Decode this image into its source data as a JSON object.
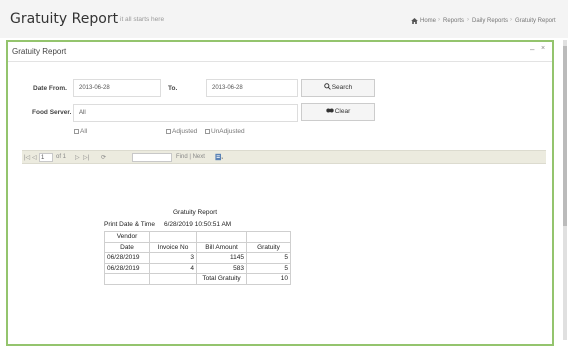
{
  "header": {
    "title": "Gratuity Report",
    "subtitle": "it all starts here",
    "breadcrumb": [
      "Home",
      "Reports",
      "Daily Reports",
      "Gratuity Report"
    ]
  },
  "panel": {
    "title": "Gratuity Report",
    "minimize": "–",
    "close": "×"
  },
  "form": {
    "date_from_label": "Date From.",
    "date_from_value": "2013-06-28",
    "to_label": "To.",
    "to_value": "2013-06-28",
    "search_label": "Search",
    "food_server_label": "Food Server.",
    "food_server_value": "All",
    "clear_label": "Clear",
    "checks": {
      "all": "All",
      "adjusted": "Adjusted",
      "unadjusted": "UnAdjusted"
    }
  },
  "viewer": {
    "first": "|◁",
    "prev": "◁",
    "page": "1",
    "of": "of 1",
    "next": "▷",
    "last": "▷|",
    "refresh": "⟳",
    "find": "Find | Next"
  },
  "report": {
    "title": "Gratuity Report",
    "print_label": "Print Date & Time",
    "print_value": "6/28/2019 10:50:51 AM",
    "vendor_header": "Vendor",
    "columns": [
      "Date",
      "Invoice No",
      "Bill Amount",
      "Gratuity"
    ],
    "rows": [
      [
        "06/28/2019",
        "3",
        "1145",
        "5"
      ],
      [
        "06/28/2019",
        "4",
        "583",
        "5"
      ]
    ],
    "total_label": "Total Gratuity",
    "total_value": "10"
  },
  "colors": {
    "panel_border": "#94c46d",
    "toolbar_bg": "#ecebdf"
  },
  "icons": [
    "home-icon",
    "search-icon",
    "clear-icon",
    "export-icon",
    "minimize-icon",
    "close-icon"
  ]
}
